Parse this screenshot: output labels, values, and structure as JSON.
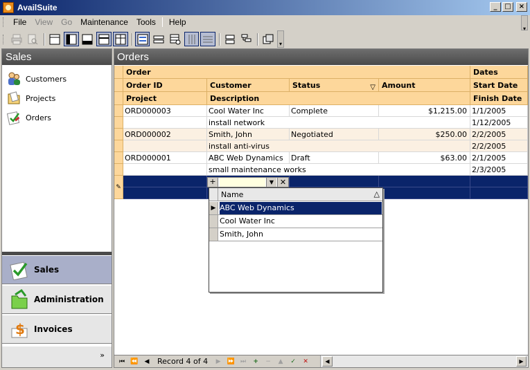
{
  "window": {
    "title": "AvailSuite"
  },
  "menu": [
    "File",
    "View",
    "Go",
    "Maintenance",
    "Tools",
    "Help"
  ],
  "menu_disabled": [
    "View",
    "Go"
  ],
  "toolbar": {
    "icons": [
      "print-icon",
      "print-preview-icon",
      "layout-normal-icon",
      "layout-sidebar-icon",
      "layout-bottom-icon",
      "layout-split-icon",
      "layout-grid-icon",
      "form-view-icon",
      "field-layout-icon",
      "filter-grid-icon",
      "grid-lines-vertical-icon",
      "grid-lines-horizontal-icon",
      "group-band-icon",
      "tree-view-icon",
      "customize-icon"
    ]
  },
  "sidebar": {
    "header": "Sales",
    "items": [
      {
        "label": "Customers",
        "icon": "customers-icon"
      },
      {
        "label": "Projects",
        "icon": "projects-icon"
      },
      {
        "label": "Orders",
        "icon": "orders-icon"
      }
    ],
    "nav_buttons": [
      {
        "label": "Sales",
        "icon": "sales-icon",
        "active": true
      },
      {
        "label": "Administration",
        "icon": "administration-icon",
        "active": false
      },
      {
        "label": "Invoices",
        "icon": "invoices-icon",
        "active": false
      }
    ]
  },
  "main": {
    "header": "Orders",
    "bands": {
      "order": "Order",
      "dates": "Dates"
    },
    "columns": {
      "row1": [
        "Order ID",
        "Customer",
        "Status",
        "Amount",
        "Start Date"
      ],
      "row2": [
        "Project",
        "Description",
        "Finish Date"
      ]
    },
    "orders": [
      {
        "order_id": "ORD000003",
        "customer": "Cool Water Inc",
        "status": "Complete",
        "amount": "$1,215.00",
        "start_date": "1/1/2005",
        "description": "install network",
        "finish_date": "1/12/2005"
      },
      {
        "order_id": "ORD000002",
        "customer": "Smith, John",
        "status": "Negotiated",
        "amount": "$250.00",
        "start_date": "2/2/2005",
        "description": "install anti-virus",
        "finish_date": "2/2/2005"
      },
      {
        "order_id": "ORD000001",
        "customer": "ABC Web Dynamics",
        "status": "Draft",
        "amount": "$63.00",
        "start_date": "2/1/2005",
        "description": "small maintenance works",
        "finish_date": "2/3/2005"
      }
    ],
    "lookup": {
      "column": "Name",
      "options": [
        "ABC Web Dynamics",
        "Cool Water Inc",
        "Smith, John"
      ],
      "selected": "ABC Web Dynamics"
    },
    "navigator": {
      "record_text": "Record 4 of 4"
    }
  },
  "colors": {
    "band": "#fdd79b",
    "selection": "#0a246a",
    "alt_row": "#fbf0e2"
  }
}
